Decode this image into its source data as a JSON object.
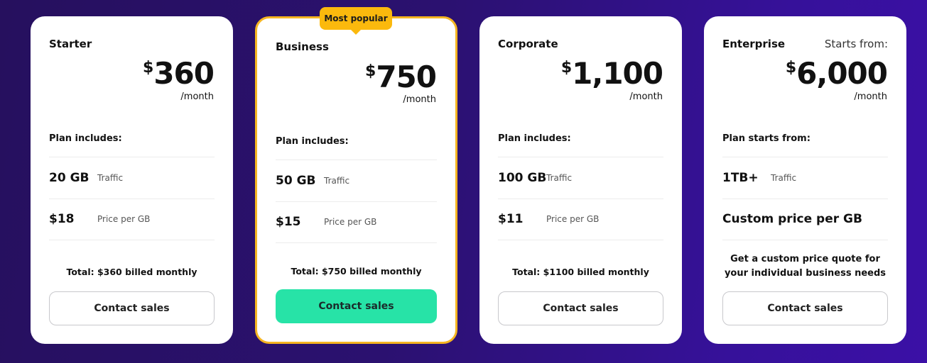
{
  "badge": {
    "label": "Most popular",
    "color": "#fbb90d"
  },
  "accent": {
    "primary_button": "#27e3a7",
    "popular_border": "#f5b521"
  },
  "plans": [
    {
      "name": "Starter",
      "starts_from": "",
      "currency": "$",
      "price": "360",
      "period": "/month",
      "includes_label": "Plan includes:",
      "traffic_value": "20 GB",
      "traffic_label": "Traffic",
      "price_per_gb_value": "$18",
      "price_per_gb_label": "Price per GB",
      "total": "Total: $360 billed monthly",
      "cta": "Contact sales"
    },
    {
      "name": "Business",
      "starts_from": "",
      "currency": "$",
      "price": "750",
      "period": "/month",
      "includes_label": "Plan includes:",
      "traffic_value": "50 GB",
      "traffic_label": "Traffic",
      "price_per_gb_value": "$15",
      "price_per_gb_label": "Price per GB",
      "total": "Total: $750 billed monthly",
      "cta": "Contact sales"
    },
    {
      "name": "Corporate",
      "starts_from": "",
      "currency": "$",
      "price": "1,100",
      "period": "/month",
      "includes_label": "Plan includes:",
      "traffic_value": "100 GB",
      "traffic_label": "Traffic",
      "price_per_gb_value": "$11",
      "price_per_gb_label": "Price per GB",
      "total": "Total: $1100 billed monthly",
      "cta": "Contact sales"
    },
    {
      "name": "Enterprise",
      "starts_from": "Starts from:",
      "currency": "$",
      "price": "6,000",
      "period": "/month",
      "includes_label": "Plan starts from:",
      "traffic_value": "1TB+",
      "traffic_label": "Traffic",
      "custom_price": "Custom price per GB",
      "quote_line1": "Get a custom price quote for",
      "quote_line2": "your individual business needs",
      "cta": "Contact sales"
    }
  ]
}
